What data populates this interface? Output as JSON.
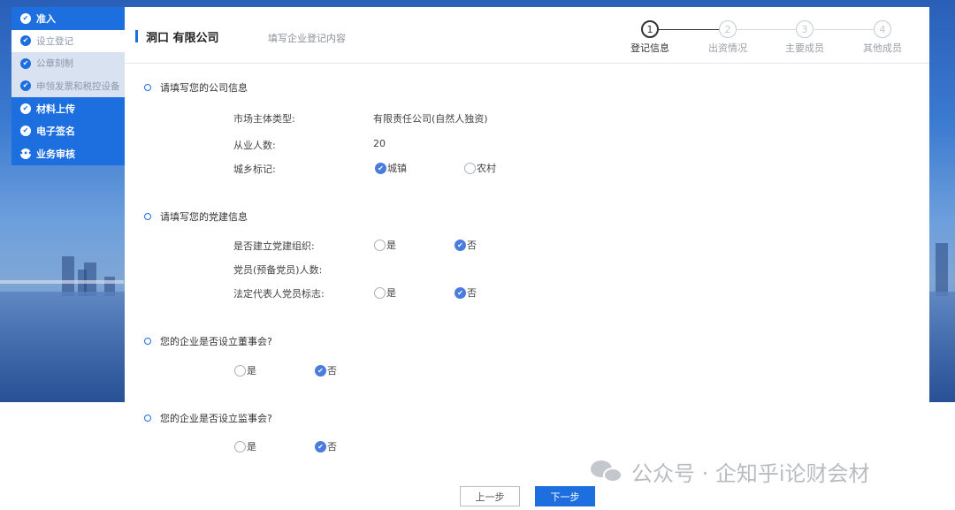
{
  "sidebar": {
    "items": [
      {
        "label": "准入",
        "type": "main"
      },
      {
        "label": "设立登记",
        "type": "sub-active"
      },
      {
        "label": "公章刻制",
        "type": "sub"
      },
      {
        "label": "申领发票和税控设备",
        "type": "sub"
      },
      {
        "label": "材料上传",
        "type": "main"
      },
      {
        "label": "电子签名",
        "type": "main"
      },
      {
        "label": "业务审核",
        "type": "main-pending"
      }
    ]
  },
  "header": {
    "company": "洞口          有限公司",
    "subtitle": "填写企业登记内容"
  },
  "steps": [
    {
      "num": "1",
      "label": "登记信息",
      "active": true
    },
    {
      "num": "2",
      "label": "出资情况",
      "active": false
    },
    {
      "num": "3",
      "label": "主要成员",
      "active": false
    },
    {
      "num": "4",
      "label": "其他成员",
      "active": false
    }
  ],
  "company_info": {
    "title": "请填写您的公司信息",
    "market_type_label": "市场主体类型:",
    "market_type_value": "有限责任公司(自然人独资)",
    "employees_label": "从业人数:",
    "employees_value": "20",
    "urban_label": "城乡标记:",
    "urban_option": "城镇",
    "rural_option": "农村",
    "urban_selected": "城镇"
  },
  "party_info": {
    "title": "请填写您的党建信息",
    "org_label": "是否建立党建组织:",
    "members_label": "党员(预备党员)人数:",
    "legal_rep_label": "法定代表人党员标志:",
    "yes": "是",
    "no": "否",
    "org_selected": "否",
    "legal_rep_selected": "否"
  },
  "board": {
    "title": "您的企业是否设立董事会?",
    "yes": "是",
    "no": "否",
    "selected": "否"
  },
  "supervisory": {
    "title": "您的企业是否设立监事会?",
    "yes": "是",
    "no": "否",
    "selected": "否"
  },
  "footer": {
    "prev_label": "上一步",
    "next_label": "下一步"
  },
  "watermark": "公众号 · 企知乎i论财会材",
  "colors": {
    "accent": "#1d6fe0",
    "radio_selected": "#4a7cde"
  }
}
